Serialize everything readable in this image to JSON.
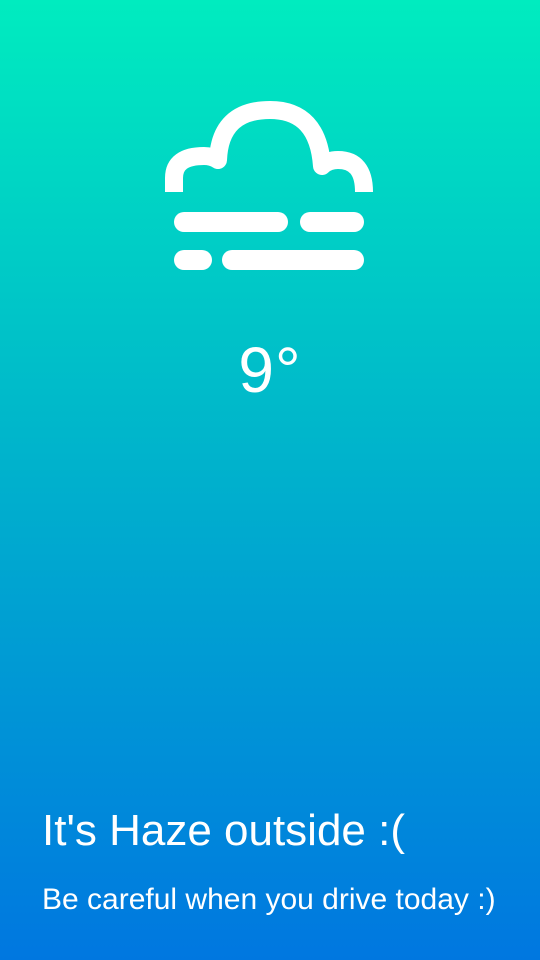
{
  "weather": {
    "condition_icon": "haze-icon",
    "temperature": "9°",
    "headline": "It's Haze outside :(",
    "advice": "Be careful when you drive today :)"
  },
  "colors": {
    "gradient_top": "#00ecbf",
    "gradient_mid": "#00b6cb",
    "gradient_bottom": "#0077e0",
    "text": "#ffffff"
  }
}
